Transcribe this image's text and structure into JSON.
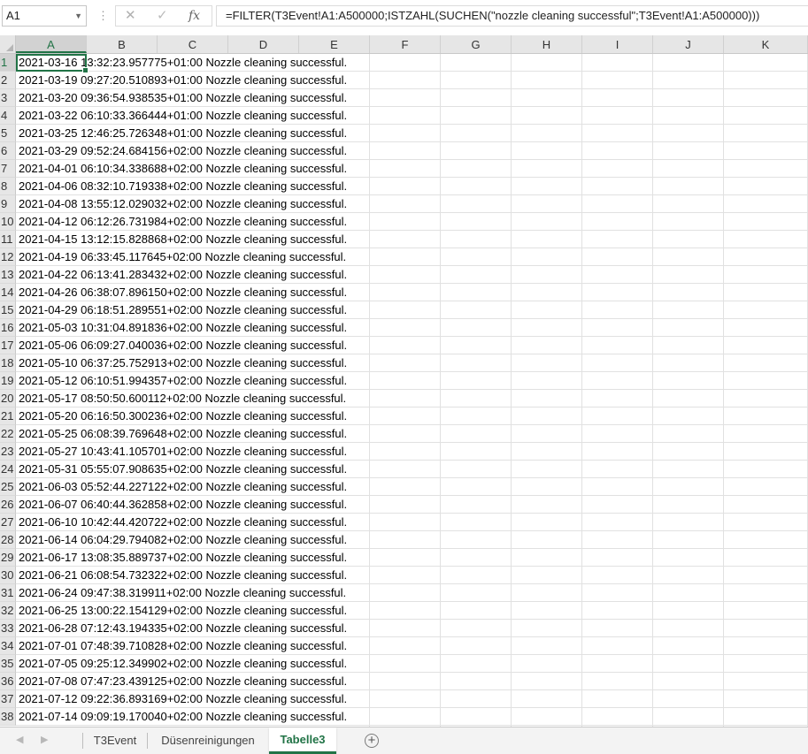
{
  "formula_bar": {
    "name_box": "A1",
    "formula": "=FILTER(T3Event!A1:A500000;ISTZAHL(SUCHEN(\"nozzle cleaning successful\";T3Event!A1:A500000)))",
    "icons": {
      "cancel": "close-icon",
      "enter": "check-icon",
      "fx": "function-icon"
    }
  },
  "columns": [
    "A",
    "B",
    "C",
    "D",
    "E",
    "F",
    "G",
    "H",
    "I",
    "J",
    "K"
  ],
  "rows": [
    {
      "num": "1",
      "value": "2021-03-16 13:32:23.957775+01:00 Nozzle cleaning successful."
    },
    {
      "num": "2",
      "value": "2021-03-19 09:27:20.510893+01:00 Nozzle cleaning successful."
    },
    {
      "num": "3",
      "value": "2021-03-20 09:36:54.938535+01:00 Nozzle cleaning successful."
    },
    {
      "num": "4",
      "value": "2021-03-22 06:10:33.366444+01:00 Nozzle cleaning successful."
    },
    {
      "num": "5",
      "value": "2021-03-25 12:46:25.726348+01:00 Nozzle cleaning successful."
    },
    {
      "num": "6",
      "value": "2021-03-29 09:52:24.684156+02:00 Nozzle cleaning successful."
    },
    {
      "num": "7",
      "value": "2021-04-01 06:10:34.338688+02:00 Nozzle cleaning successful."
    },
    {
      "num": "8",
      "value": "2021-04-06 08:32:10.719338+02:00 Nozzle cleaning successful."
    },
    {
      "num": "9",
      "value": "2021-04-08 13:55:12.029032+02:00 Nozzle cleaning successful."
    },
    {
      "num": "10",
      "value": "2021-04-12 06:12:26.731984+02:00 Nozzle cleaning successful."
    },
    {
      "num": "11",
      "value": "2021-04-15 13:12:15.828868+02:00 Nozzle cleaning successful."
    },
    {
      "num": "12",
      "value": "2021-04-19 06:33:45.117645+02:00 Nozzle cleaning successful."
    },
    {
      "num": "13",
      "value": "2021-04-22 06:13:41.283432+02:00 Nozzle cleaning successful."
    },
    {
      "num": "14",
      "value": "2021-04-26 06:38:07.896150+02:00 Nozzle cleaning successful."
    },
    {
      "num": "15",
      "value": "2021-04-29 06:18:51.289551+02:00 Nozzle cleaning successful."
    },
    {
      "num": "16",
      "value": "2021-05-03 10:31:04.891836+02:00 Nozzle cleaning successful."
    },
    {
      "num": "17",
      "value": "2021-05-06 06:09:27.040036+02:00 Nozzle cleaning successful."
    },
    {
      "num": "18",
      "value": "2021-05-10 06:37:25.752913+02:00 Nozzle cleaning successful."
    },
    {
      "num": "19",
      "value": "2021-05-12 06:10:51.994357+02:00 Nozzle cleaning successful."
    },
    {
      "num": "20",
      "value": "2021-05-17 08:50:50.600112+02:00 Nozzle cleaning successful."
    },
    {
      "num": "21",
      "value": "2021-05-20 06:16:50.300236+02:00 Nozzle cleaning successful."
    },
    {
      "num": "22",
      "value": "2021-05-25 06:08:39.769648+02:00 Nozzle cleaning successful."
    },
    {
      "num": "23",
      "value": "2021-05-27 10:43:41.105701+02:00 Nozzle cleaning successful."
    },
    {
      "num": "24",
      "value": "2021-05-31 05:55:07.908635+02:00 Nozzle cleaning successful."
    },
    {
      "num": "25",
      "value": "2021-06-03 05:52:44.227122+02:00 Nozzle cleaning successful."
    },
    {
      "num": "26",
      "value": "2021-06-07 06:40:44.362858+02:00 Nozzle cleaning successful."
    },
    {
      "num": "27",
      "value": "2021-06-10 10:42:44.420722+02:00 Nozzle cleaning successful."
    },
    {
      "num": "28",
      "value": "2021-06-14 06:04:29.794082+02:00 Nozzle cleaning successful."
    },
    {
      "num": "29",
      "value": "2021-06-17 13:08:35.889737+02:00 Nozzle cleaning successful."
    },
    {
      "num": "30",
      "value": "2021-06-21 06:08:54.732322+02:00 Nozzle cleaning successful."
    },
    {
      "num": "31",
      "value": "2021-06-24 09:47:38.319911+02:00 Nozzle cleaning successful."
    },
    {
      "num": "32",
      "value": "2021-06-25 13:00:22.154129+02:00 Nozzle cleaning successful."
    },
    {
      "num": "33",
      "value": "2021-06-28 07:12:43.194335+02:00 Nozzle cleaning successful."
    },
    {
      "num": "34",
      "value": "2021-07-01 07:48:39.710828+02:00 Nozzle cleaning successful."
    },
    {
      "num": "35",
      "value": "2021-07-05 09:25:12.349902+02:00 Nozzle cleaning successful."
    },
    {
      "num": "36",
      "value": "2021-07-08 07:47:23.439125+02:00 Nozzle cleaning successful."
    },
    {
      "num": "37",
      "value": "2021-07-12 09:22:36.893169+02:00 Nozzle cleaning successful."
    },
    {
      "num": "38",
      "value": "2021-07-14 09:09:19.170040+02:00 Nozzle cleaning successful."
    }
  ],
  "sheet_tabs": [
    {
      "label": "T3Event",
      "active": false
    },
    {
      "label": "Düsenreinigungen",
      "active": false
    },
    {
      "label": "Tabelle3",
      "active": true
    }
  ],
  "colors": {
    "accent": "#217346",
    "header_bg": "#e6e6e6",
    "gridline": "#e1e1e1"
  }
}
